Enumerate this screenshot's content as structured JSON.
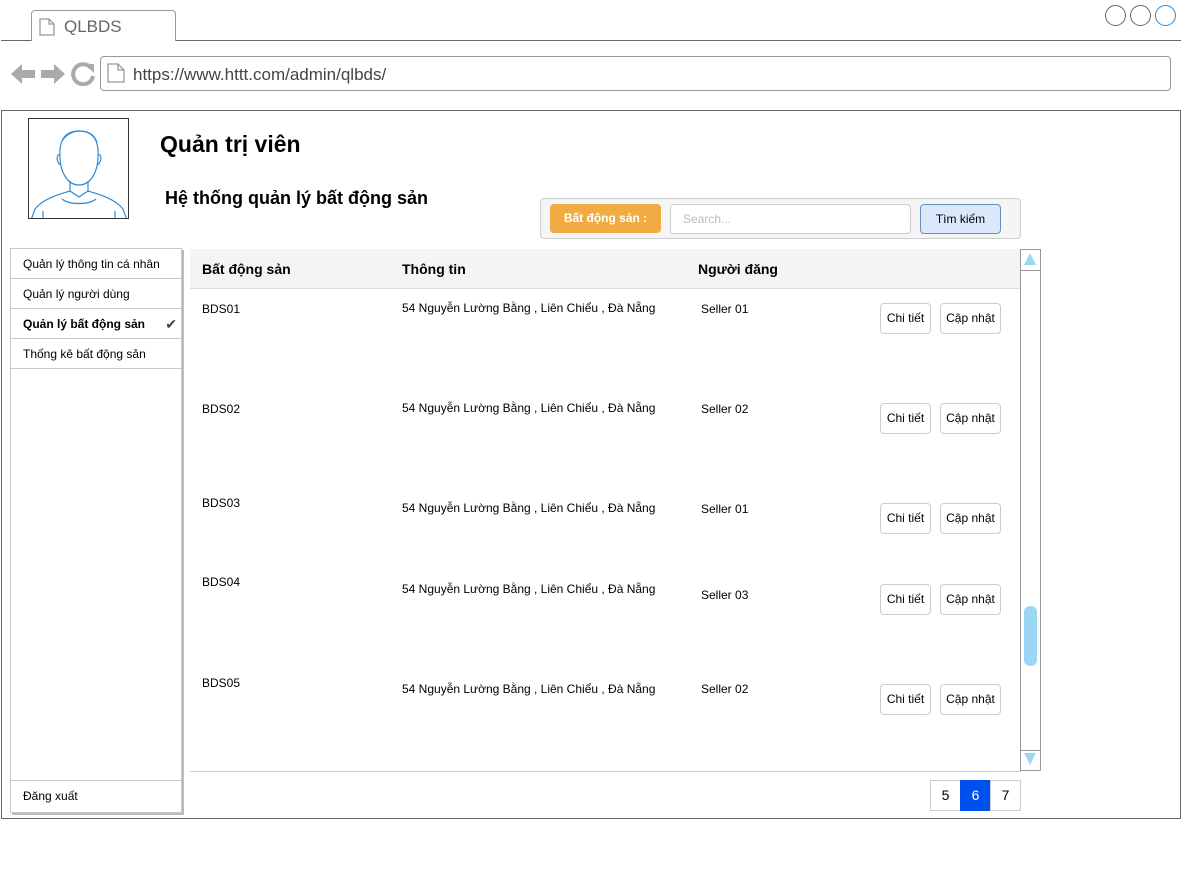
{
  "browser": {
    "tab_title": "QLBDS",
    "url": "https://www.httt.com/admin/qlbds/"
  },
  "header": {
    "title": "Quản trị viên",
    "subtitle": "Hệ thống quản lý bất động sản"
  },
  "search": {
    "label": "Bất động sản :",
    "placeholder": "Search...",
    "button_label": "Tìm kiếm"
  },
  "sidebar": {
    "items": [
      {
        "label": "Quản lý thông tin cá nhân"
      },
      {
        "label": "Quản lý người dùng"
      },
      {
        "label": "Quản lý bất động sản",
        "active": true
      },
      {
        "label": "Thống kê bất động sản"
      }
    ],
    "logout_label": "Đăng xuất"
  },
  "table": {
    "columns": [
      "Bất động sản",
      "Thông tin",
      "Người đăng"
    ],
    "rows": [
      {
        "id": "BDS01",
        "info": "54 Nguyễn Lường Bằng , Liên Chiểu , Đà Nẵng",
        "poster": "Seller 01"
      },
      {
        "id": "BDS02",
        "info": "54 Nguyễn Lường Bằng , Liên Chiểu , Đà Nẵng",
        "poster": "Seller 02"
      },
      {
        "id": "BDS03",
        "info": "54 Nguyễn Lường Bằng , Liên Chiểu , Đà Nẵng",
        "poster": "Seller 01"
      },
      {
        "id": "BDS04",
        "info": "54 Nguyễn Lường Bằng , Liên Chiểu , Đà Nẵng",
        "poster": "Seller 03"
      },
      {
        "id": "BDS05",
        "info": "54 Nguyễn Lường Bằng , Liên Chiểu , Đà Nẵng",
        "poster": "Seller 02"
      }
    ],
    "detail_label": "Chi tiết",
    "update_label": "Cập nhật"
  },
  "pagination": {
    "pages": [
      "5",
      "6",
      "7"
    ],
    "current": "6"
  }
}
